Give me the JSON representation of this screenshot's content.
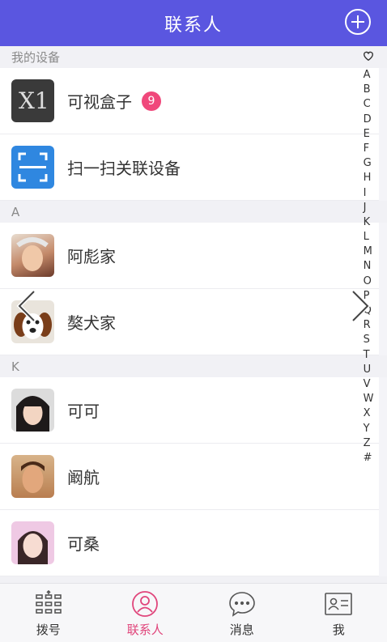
{
  "header": {
    "title": "联系人",
    "add_icon": "plus-circle-icon"
  },
  "sections": [
    {
      "title": "我的设备",
      "rows": [
        {
          "label": "可视盒子",
          "avatar": "x1-device",
          "badge": "9"
        },
        {
          "label": "扫一扫关联设备",
          "avatar": "scan-icon"
        }
      ]
    },
    {
      "title": "A",
      "rows": [
        {
          "label": "阿彪家",
          "avatar": "photo-woman-flowers"
        },
        {
          "label": "獒犬家",
          "avatar": "photo-dog"
        }
      ]
    },
    {
      "title": "K",
      "rows": [
        {
          "label": "可可",
          "avatar": "photo-woman-short-hair"
        },
        {
          "label": "阚航",
          "avatar": "photo-man"
        },
        {
          "label": "可桑",
          "avatar": "photo-woman-pink"
        }
      ]
    }
  ],
  "index": [
    "A",
    "B",
    "C",
    "D",
    "E",
    "F",
    "G",
    "H",
    "I",
    "J",
    "K",
    "L",
    "M",
    "N",
    "O",
    "P",
    "Q",
    "R",
    "S",
    "T",
    "U",
    "V",
    "W",
    "X",
    "Y",
    "Z",
    "#"
  ],
  "tabs": [
    {
      "label": "拨号",
      "icon": "dialpad-icon"
    },
    {
      "label": "联系人",
      "icon": "contact-icon",
      "active": true
    },
    {
      "label": "消息",
      "icon": "message-icon"
    },
    {
      "label": "我",
      "icon": "profile-card-icon"
    }
  ],
  "colors": {
    "header": "#5a56e0",
    "active_tab": "#e0457b",
    "badge": "#f0487b",
    "scan": "#2f87e0"
  }
}
